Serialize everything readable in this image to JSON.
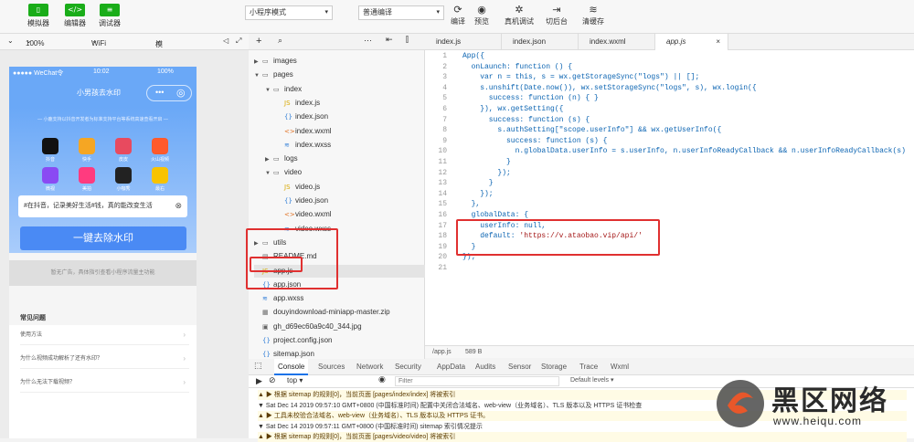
{
  "toolbar": {
    "buttons": [
      {
        "icon": "phone-icon",
        "label": "模拟器"
      },
      {
        "icon": "code-icon",
        "label": "编辑器"
      },
      {
        "icon": "debug-icon",
        "label": "调试器"
      }
    ],
    "mode_select": "小程序模式",
    "compile_select": "普通编译",
    "actions": [
      {
        "icon": "refresh-icon",
        "label": "编译"
      },
      {
        "icon": "eye-icon",
        "label": "预览"
      },
      {
        "icon": "bug-icon",
        "label": "真机调试"
      },
      {
        "icon": "switch-icon",
        "label": "切后台"
      },
      {
        "icon": "layers-icon",
        "label": "清缓存"
      }
    ]
  },
  "simulator_bar": {
    "device": "",
    "zoom": "100%",
    "network": "WiFi",
    "operation": "模拟操作"
  },
  "phone": {
    "carrier": "●●●●● WeChat令",
    "time": "10:02",
    "battery": "100%",
    "title": "小男孩去水印",
    "notice": "— 小鹿支持以抖音开发者为标准支持平台等系统高速查看开启 —",
    "apps": [
      {
        "label": "抖音",
        "color": "#111111"
      },
      {
        "label": "快手",
        "color": "#f5a623"
      },
      {
        "label": "皮皮",
        "color": "#e84a5f"
      },
      {
        "label": "火山视频",
        "color": "#ff5a2c"
      },
      {
        "label": "微视",
        "color": "#8a4af3"
      },
      {
        "label": "美拍",
        "color": "#ff3b7f"
      },
      {
        "label": "小咖秀",
        "color": "#222222"
      },
      {
        "label": "最右",
        "color": "#f8c300"
      }
    ],
    "input_value": "#在抖音，记录美好生活#钱，真的能改变生活",
    "main_button": "一键去除水印",
    "ad_text": "暂无广告，具体指引查看小程序流量主功能",
    "faq_title": "常见问题",
    "faq_items": [
      "使用方法",
      "为什么视频成功解析了还有水印？",
      "为什么无法下载视频？"
    ]
  },
  "explorer": {
    "tree": [
      {
        "name": "images",
        "type": "folder",
        "depth": 0,
        "open": false
      },
      {
        "name": "pages",
        "type": "folder",
        "depth": 0,
        "open": true
      },
      {
        "name": "index",
        "type": "folder",
        "depth": 1,
        "open": true
      },
      {
        "name": "index.js",
        "type": "js",
        "depth": 2
      },
      {
        "name": "index.json",
        "type": "json",
        "depth": 2
      },
      {
        "name": "index.wxml",
        "type": "wxml",
        "depth": 2
      },
      {
        "name": "index.wxss",
        "type": "wxss",
        "depth": 2
      },
      {
        "name": "logs",
        "type": "folder",
        "depth": 1,
        "open": false
      },
      {
        "name": "video",
        "type": "folder",
        "depth": 1,
        "open": true
      },
      {
        "name": "video.js",
        "type": "js",
        "depth": 2
      },
      {
        "name": "video.json",
        "type": "json",
        "depth": 2
      },
      {
        "name": "video.wxml",
        "type": "wxml",
        "depth": 2
      },
      {
        "name": "video.wxss",
        "type": "wxss",
        "depth": 2
      },
      {
        "name": "utils",
        "type": "folder",
        "depth": 0,
        "open": false
      },
      {
        "name": "README.md",
        "type": "md",
        "depth": 0
      },
      {
        "name": "app.js",
        "type": "js",
        "depth": 0,
        "selected": true
      },
      {
        "name": "app.json",
        "type": "json",
        "depth": 0
      },
      {
        "name": "app.wxss",
        "type": "wxss",
        "depth": 0
      },
      {
        "name": "douyindownload-miniapp-master.zip",
        "type": "zip",
        "depth": 0
      },
      {
        "name": "gh_d69ec60a9c40_344.jpg",
        "type": "img",
        "depth": 0
      },
      {
        "name": "project.config.json",
        "type": "json",
        "depth": 0
      },
      {
        "name": "sitemap.json",
        "type": "json",
        "depth": 0
      }
    ]
  },
  "editor": {
    "tabs": [
      "index.js",
      "index.json",
      "index.wxml",
      "app.js"
    ],
    "active_tab": "app.js",
    "lines": [
      "App({",
      "  onLaunch: function () {",
      "    var n = this, s = wx.getStorageSync(\"logs\") || [];",
      "    s.unshift(Date.now()), wx.setStorageSync(\"logs\", s), wx.login({",
      "      success: function (n) { }",
      "    }), wx.getSetting({",
      "      success: function (s) {",
      "        s.authSetting[\"scope.userInfo\"] && wx.getUserInfo({",
      "          success: function (s) {",
      "            n.globalData.userInfo = s.userInfo, n.userInfoReadyCallback && n.userInfoReadyCallback(s)",
      "          }",
      "        });",
      "      }",
      "    });",
      "  },",
      "  globalData: {",
      "    userInfo: null,",
      "    default: 'https://v.ataobao.vip/api/'",
      "  }",
      "});",
      ""
    ],
    "file_path": "/app.js",
    "file_size": "589 B"
  },
  "console": {
    "tabs": [
      "Console",
      "Sources",
      "Network",
      "Security",
      "AppData",
      "Audits",
      "Sensor",
      "Storage",
      "Trace",
      "Wxml"
    ],
    "context": "top",
    "filter_placeholder": "Filter",
    "levels": "Default levels ▾",
    "logs": [
      {
        "text": "▲ ▶ 根据 sitemap 的规则[0]，当前页面 [pages/index/index] 将被索引",
        "warn": true
      },
      {
        "text": "▼ Sat Dec 14 2019 09:57:10 GMT+0800 (中国标准时间) 配置中关闭合法域名、web-view（业务域名）、TLS 版本以及 HTTPS 证书检查",
        "warn": false
      },
      {
        "text": "▲ ▶ 工具未校验合法域名、web-view（业务域名）、TLS 版本以及 HTTPS 证书。",
        "warn": true
      },
      {
        "text": "▼ Sat Dec 14 2019 09:57:11 GMT+0800 (中国标准时间) sitemap 索引情况提示",
        "warn": false
      },
      {
        "text": "▲ ▶ 根据 sitemap 的规则[0]，当前页面 [pages/video/video] 将被索引",
        "warn": true
      }
    ]
  },
  "watermark": {
    "brand": "黑区网络",
    "url": "www.heiqu.com"
  }
}
